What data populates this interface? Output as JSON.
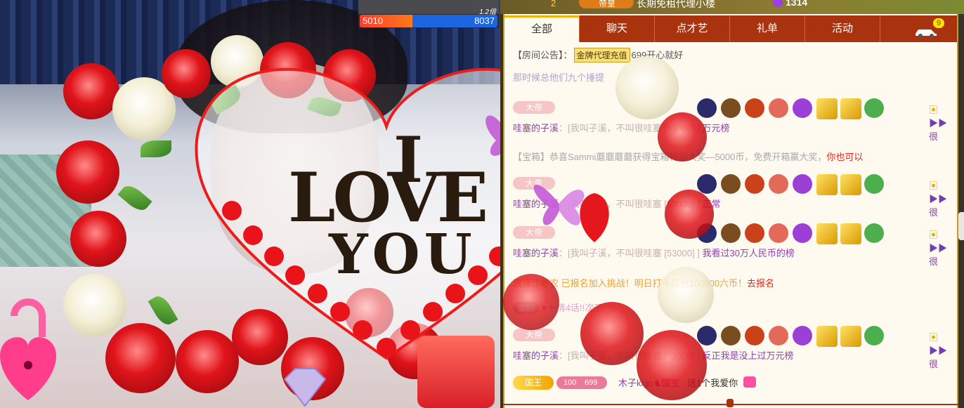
{
  "pk": {
    "left_score": "5010",
    "right_score": "8037",
    "multiplier": "1.2倍",
    "left_fraction": 0.384
  },
  "top_strip": {
    "count": "2",
    "vip_label": "帝皇",
    "name": "长期免租代理小楼",
    "number": "1314"
  },
  "tabs": [
    {
      "label": "全部"
    },
    {
      "label": "聊天"
    },
    {
      "label": "点才艺"
    },
    {
      "label": "礼单"
    },
    {
      "label": "活动"
    }
  ],
  "car_badge": "9",
  "notice": {
    "prefix": "【房间公告】：",
    "agent_tag": "金牌代理充值",
    "message": "699开心就好"
  },
  "chat": [
    {
      "tag": "大帝",
      "sub_self": "哇塞的子溪",
      "sub_mid": "：[我叫子溪，不叫很哇塞 [53000] ]",
      "text": "万元榜",
      "more": "很"
    },
    {
      "tag": "大帝",
      "sub_self": "哇塞的子溪",
      "sub_mid": "：[我叫子溪，不叫很哇塞 [53000] ]",
      "text": "正常",
      "more": "很"
    },
    {
      "tag": "大帝",
      "sub_self": "哇塞的子溪",
      "sub_mid": "：[我叫子溪，不叫很哇塞 [53000] ]",
      "text": "我看过30万人民币的榜",
      "more": "很"
    },
    {
      "tag": "大帝",
      "sub_self": "哇塞的子溪",
      "sub_mid": "：[我叫子溪，不叫很哇塞 [53000] ]",
      "text": "反正我是没上过万元榜",
      "more": "很"
    }
  ],
  "system": {
    "treasure": "【宝箱】恭喜Sammi蘑蘑蘑蘑获得宝箱特别大奖—5000币，免费开箱赢大奖，",
    "treasure_link": "你也可以",
    "challenge": "浪漫江老农 已报名加入挑战！明日打卡瓜分100000六币！",
    "challenge_link": "去报名",
    "fu_tag": "富17",
    "fu_msg": "♥十情4话!!次了",
    "partial_top": "那时候总他们九个捶提"
  },
  "last": {
    "tag": "国王",
    "level_a": "100",
    "level_b": "699",
    "who": "木子kigo",
    "guobao": "国宝",
    "action": "送1个我爱你"
  },
  "overlay": {
    "love_i": "I",
    "love_love": "LOVE",
    "love_you": "YOU"
  }
}
